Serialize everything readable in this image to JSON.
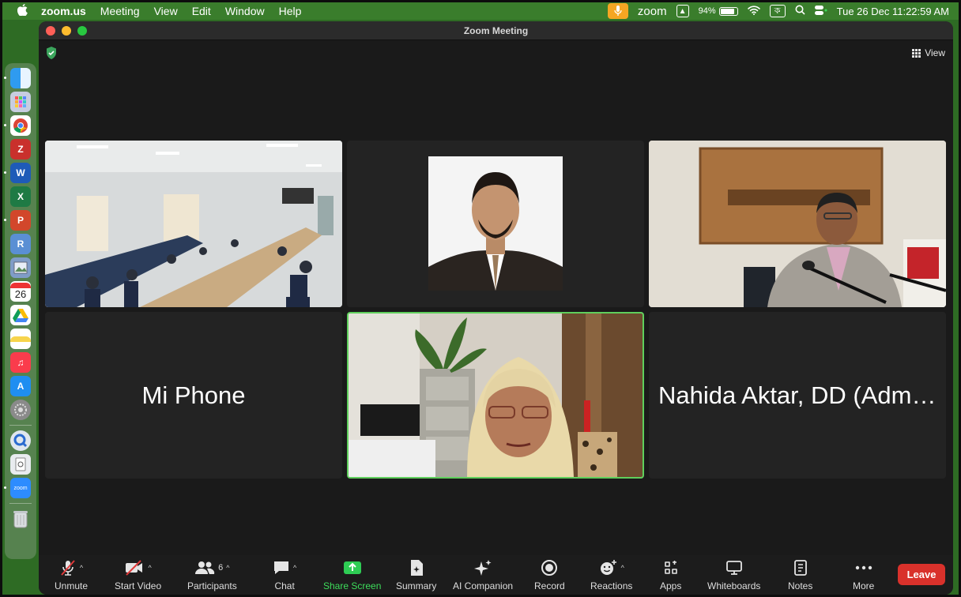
{
  "menubar": {
    "app_name": "zoom.us",
    "menus": [
      "Meeting",
      "View",
      "Edit",
      "Window",
      "Help"
    ],
    "zoom_label": "zoom",
    "battery_percent": "94%",
    "keyboard_label": "ক",
    "datetime": "Tue 26 Dec  11:22:59 AM"
  },
  "dock": {
    "calendar_day": "26",
    "items": [
      "finder-icon",
      "launchpad-icon",
      "chrome-icon",
      "zotero-icon",
      "word-icon",
      "excel-icon",
      "powerpoint-icon",
      "r-icon",
      "preview-icon",
      "calendar-icon",
      "drive-icon",
      "notes-icon",
      "music-icon",
      "appstore-icon",
      "settings-icon",
      "quicktime-icon",
      "preview2-icon",
      "zoom-icon",
      "trash-icon"
    ]
  },
  "window": {
    "title": "Zoom Meeting",
    "view_label": "View"
  },
  "tiles": [
    {
      "id": "conference-room",
      "type": "video"
    },
    {
      "id": "profile-photo",
      "type": "photo"
    },
    {
      "id": "speaker-room",
      "type": "video"
    },
    {
      "id": "mi-phone",
      "type": "name",
      "name": "Mi Phone"
    },
    {
      "id": "active-speaker",
      "type": "video",
      "active": true
    },
    {
      "id": "nahida",
      "type": "name",
      "name": "Nahida Aktar, DD (Admi..."
    }
  ],
  "toolbar": {
    "unmute": "Unmute",
    "start_video": "Start Video",
    "participants": "Participants",
    "participants_count": "6",
    "chat": "Chat",
    "share_screen": "Share Screen",
    "summary": "Summary",
    "ai_companion": "AI Companion",
    "record": "Record",
    "reactions": "Reactions",
    "apps": "Apps",
    "whiteboards": "Whiteboards",
    "notes": "Notes",
    "more": "More",
    "leave": "Leave"
  },
  "colors": {
    "accent_green": "#3ddc5b",
    "leave_red": "#d9312b",
    "desktop_green": "#2e6b24"
  }
}
